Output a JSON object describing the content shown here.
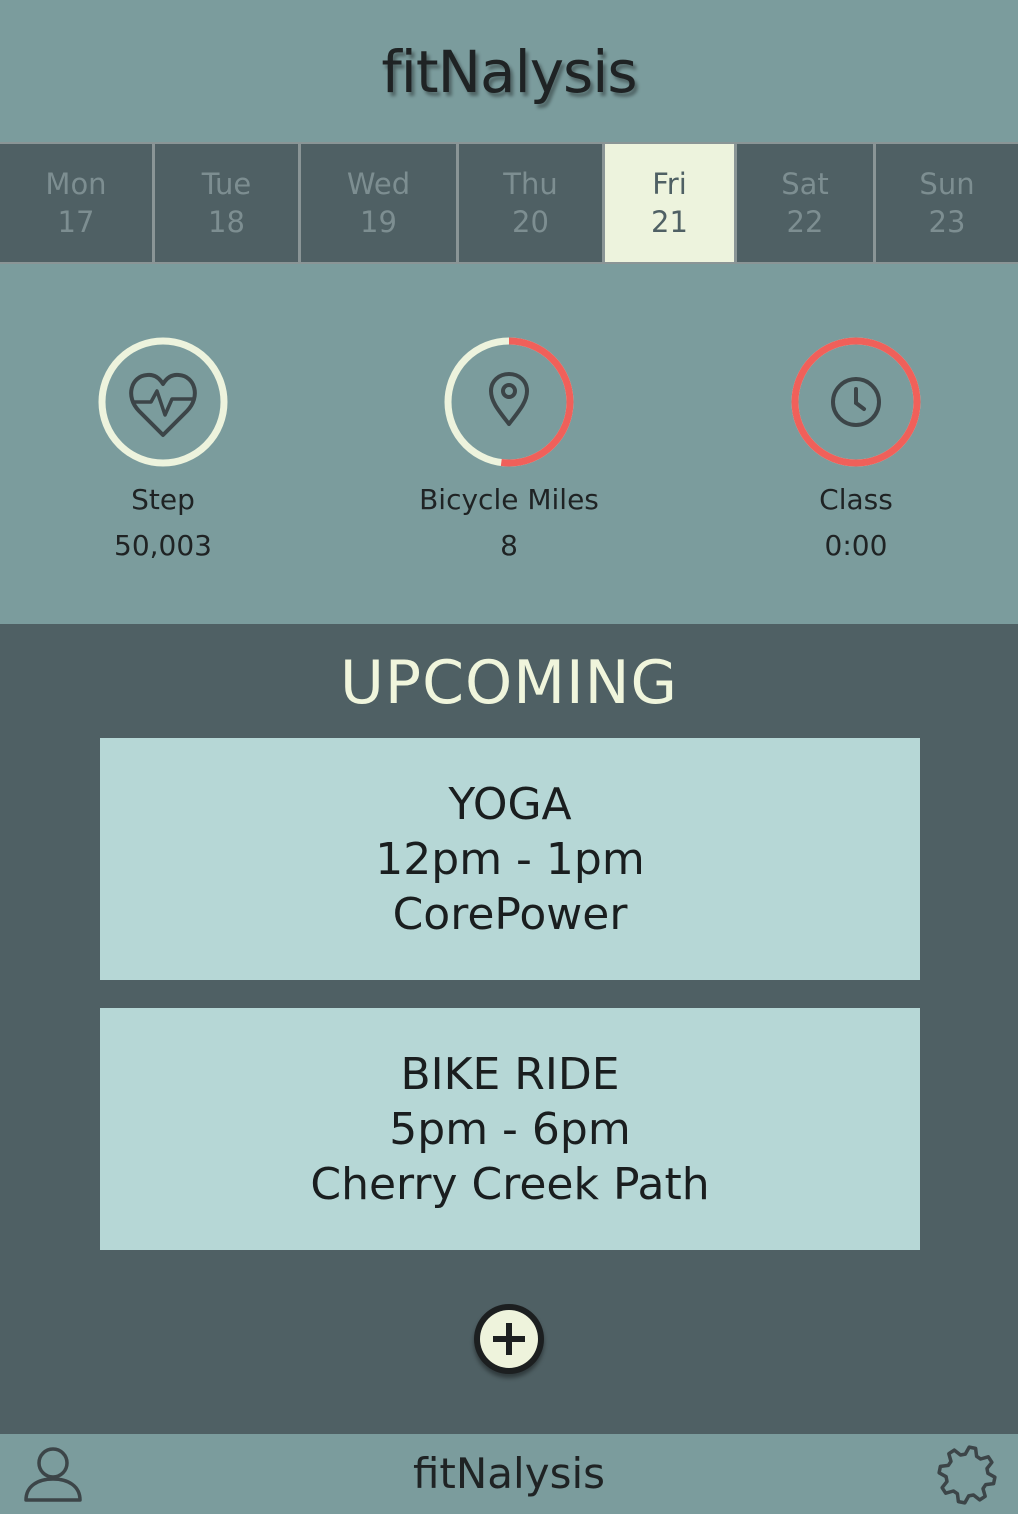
{
  "app": {
    "title": "fitNalysis"
  },
  "days": [
    {
      "name": "Mon",
      "date": "17",
      "selected": false
    },
    {
      "name": "Tue",
      "date": "18",
      "selected": false
    },
    {
      "name": "Wed",
      "date": "19",
      "selected": false
    },
    {
      "name": "Thu",
      "date": "20",
      "selected": false
    },
    {
      "name": "Fri",
      "date": "21",
      "selected": true
    },
    {
      "name": "Sat",
      "date": "22",
      "selected": false
    },
    {
      "name": "Sun",
      "date": "23",
      "selected": false
    }
  ],
  "stats": [
    {
      "label": "Step",
      "value": "50,003",
      "icon": "heartbeat-icon",
      "progress": 0
    },
    {
      "label": "Bicycle Miles",
      "value": "8",
      "icon": "map-pin-icon",
      "progress": 0.52
    },
    {
      "label": "Class",
      "value": "0:00",
      "icon": "clock-icon",
      "progress": 1.0
    }
  ],
  "upcoming": {
    "title": "UPCOMING",
    "events": [
      {
        "name": "YOGA",
        "time": "12pm - 1pm",
        "location": "CorePower"
      },
      {
        "name": "BIKE RIDE",
        "time": "5pm - 6pm",
        "location": "Cherry Creek Path"
      }
    ],
    "add_icon": "plus-icon"
  },
  "footer": {
    "title": "fitNalysis",
    "left_icon": "user-icon",
    "right_icon": "gear-icon"
  },
  "colors": {
    "background": "#7b9c9d",
    "dark_panel": "#4f6064",
    "accent_light": "#edf3dd",
    "progress_red": "#f0605a",
    "card": "#b6d7d6"
  }
}
